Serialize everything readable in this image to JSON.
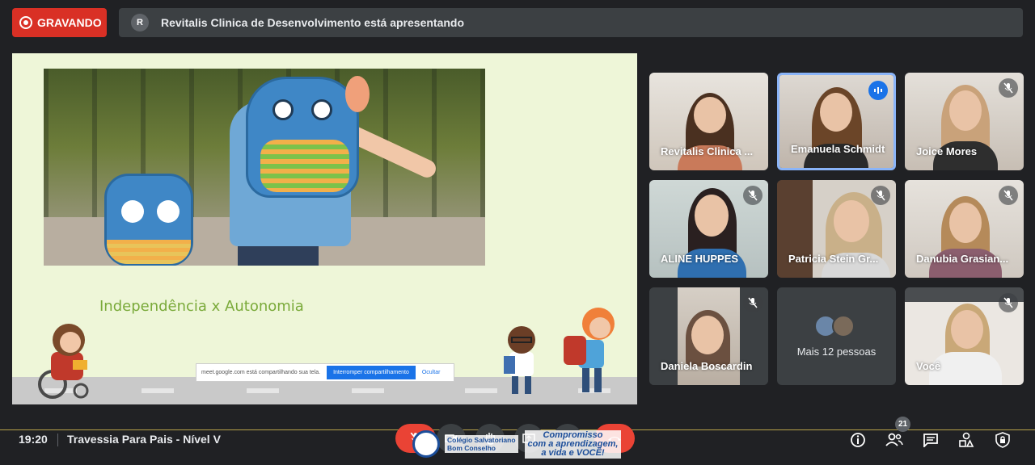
{
  "recording": {
    "label": "GRAVANDO"
  },
  "presenter_banner": {
    "avatar_letter": "R",
    "text": "Revitalis Clinica de Desenvolvimento está apresentando"
  },
  "slide": {
    "title": "Independência x Autonomia",
    "share_notice": {
      "text": "meet.google.com está compartilhando sua tela.",
      "stop_label": "Interromper compartilhamento",
      "hide_label": "Ocultar"
    }
  },
  "participants": [
    {
      "name": "Revitalis Clinica ...",
      "muted": false,
      "speaking": false
    },
    {
      "name": "Emanuela Schmidt",
      "muted": false,
      "speaking": true
    },
    {
      "name": "Joice Mores",
      "muted": true,
      "speaking": false
    },
    {
      "name": "ALINE HUPPES",
      "muted": true,
      "speaking": false
    },
    {
      "name": "Patricia Stein Gr...",
      "muted": true,
      "speaking": false
    },
    {
      "name": "Danubia Grasian...",
      "muted": true,
      "speaking": false
    },
    {
      "name": "Daniela Boscardin",
      "muted": true,
      "speaking": false
    }
  ],
  "more_people": {
    "label": "Mais 12 pessoas"
  },
  "self_tile": {
    "name": "Você",
    "muted": true
  },
  "bottom": {
    "time": "19:20",
    "meeting_title": "Travessia Para Pais - Nível V",
    "participant_count": "21",
    "school_name_line1": "Colégio Salvatoriano",
    "school_name_line2": "Bom Conselho",
    "slogan_line1": "Compromisso",
    "slogan_line2": "com a aprendizagem,",
    "slogan_line3": "a vida e VOCÊ!"
  },
  "colors": {
    "record_red": "#d93025",
    "speaking_blue": "#1a73e8",
    "tile_bg": "#3c4043",
    "slide_title_green": "#7aaa3a"
  }
}
